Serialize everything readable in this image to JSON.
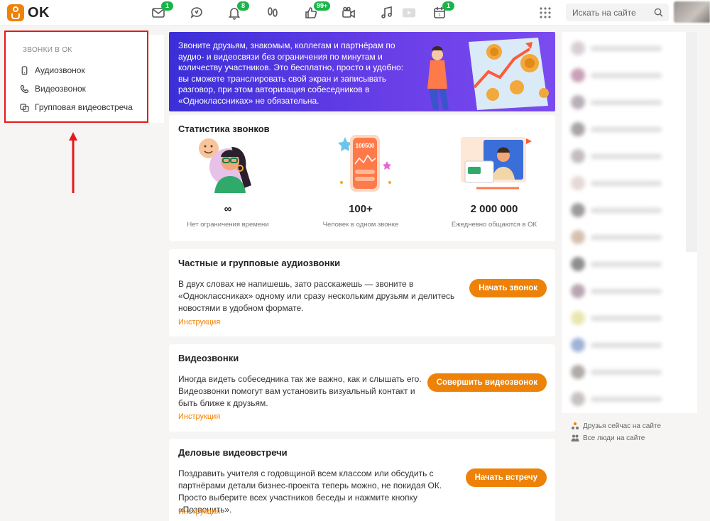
{
  "app": {
    "name": "OK"
  },
  "topbar": {
    "badges": {
      "messages": "1",
      "notifications": "8",
      "likes": "99+",
      "calendar": "1"
    },
    "search": {
      "placeholder": "Искать на сайте"
    }
  },
  "sidebar": {
    "section_title": "ЗВОНКИ В ОК",
    "items": [
      {
        "label": "Аудиозвонок",
        "icon": "phone-icon"
      },
      {
        "label": "Видеозвонок",
        "icon": "handset-icon"
      },
      {
        "label": "Групповая видеовстреча",
        "icon": "group-video-icon"
      }
    ]
  },
  "banner": {
    "text": "Звоните друзьям, знакомым, коллегам и партнёрам по аудио- и видеосвязи без ограничения по минутам и количеству участников. Это бесплатно, просто и удобно: вы сможете транслировать свой экран и записывать разговор, при этом авторизация собеседников в «Одноклассниках» не обязательна."
  },
  "stats": {
    "title": "Статистика звонков",
    "items": [
      {
        "value": "∞",
        "label": "Нет ограничения времени"
      },
      {
        "value": "100+",
        "label": "Человек в одном звонке",
        "illus_text": "100500"
      },
      {
        "value": "2 000 000",
        "label": "Ежедневно общаются в ОК"
      }
    ]
  },
  "audio_card": {
    "title": "Частные и групповые аудиозвонки",
    "text": "В двух словах не напишешь, зато расскажешь — звоните в «Одноклассниках» одному или сразу нескольким друзьям и делитесь новостями в удобном формате.",
    "link": "Инструкция",
    "button": "Начать звонок"
  },
  "video_card": {
    "title": "Видеозвонки",
    "text": "Иногда видеть собеседника так же важно, как и слышать его. Видеозвонки помогут вам установить визуальный контакт и быть ближе к друзьям.",
    "link": "Инструкция",
    "button": "Совершить видеозвонок"
  },
  "business_card": {
    "title": "Деловые видеовстречи",
    "text": "Поздравить учителя с годовщиной всем классом или обсудить с партнёрами детали бизнес-проекта теперь можно, не покидая ОК. Просто выберите всех участников беседы и нажмите кнопку «Позвонить».",
    "link": "Инструкция",
    "button": "Начать встречу"
  },
  "right": {
    "friends_online": "Друзья сейчас на сайте",
    "all_people": "Все люди на сайте"
  },
  "colors": {
    "accent": "#ee8208",
    "badge": "#1ab54a",
    "highlight": "#e5191b",
    "banner": "#4b34e0"
  }
}
